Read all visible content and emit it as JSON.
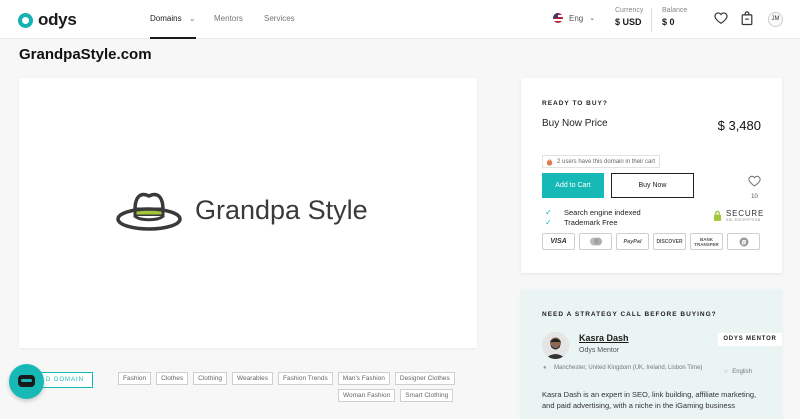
{
  "header": {
    "logo_text": "odys",
    "nav": [
      {
        "label": "Domains",
        "active": true
      },
      {
        "label": "Mentors",
        "active": false
      },
      {
        "label": "Services",
        "active": false
      }
    ],
    "language": "Eng",
    "currency_label": "Currency",
    "currency_value": "$ USD",
    "balance_label": "Balance",
    "balance_value": "$ 0",
    "user_initials": "JM"
  },
  "page": {
    "title": "GrandpaStyle.com"
  },
  "logo_card": {
    "brand_text": "Grandpa Style"
  },
  "buy": {
    "heading": "READY TO BUY?",
    "price_label": "Buy Now Price",
    "price": "$ 3,480",
    "cart_note": "2 users have this domain in their cart",
    "add_to_cart": "Add to Cart",
    "buy_now": "Buy Now",
    "favorites_count": "10",
    "features": [
      "Search engine indexed",
      "Trademark Free"
    ],
    "secure_title": "SECURE",
    "secure_sub": "SSL ENCRYPTION",
    "payment_methods": [
      "VISA",
      "mastercard",
      "PayPal",
      "DISCOVER",
      "BANK TRANSFER",
      "bitcoin"
    ]
  },
  "strategy": {
    "heading": "NEED A STRATEGY CALL BEFORE BUYING?",
    "badge": "ODYS MENTOR",
    "mentor_name": "Kasra Dash",
    "mentor_role": "Odys Mentor",
    "location": "Manchester, United Kingdom (UK, Ireland, Lisbon Time)",
    "language": "English",
    "bio": "Kasra Dash is an expert in SEO, link building, affiliate marketing, and paid advertising, with a niche in the iGaming business"
  },
  "add_domain": "D DOMAIN",
  "tags": [
    "Fashion",
    "Clothes",
    "Clothing",
    "Wearables",
    "Fashion Trends",
    "Man's Fashion",
    "Designer Clothes",
    "Woman Fashion",
    "Smart Clothing"
  ],
  "colors": {
    "accent": "#17b9b6",
    "text": "#1f1f1f"
  }
}
